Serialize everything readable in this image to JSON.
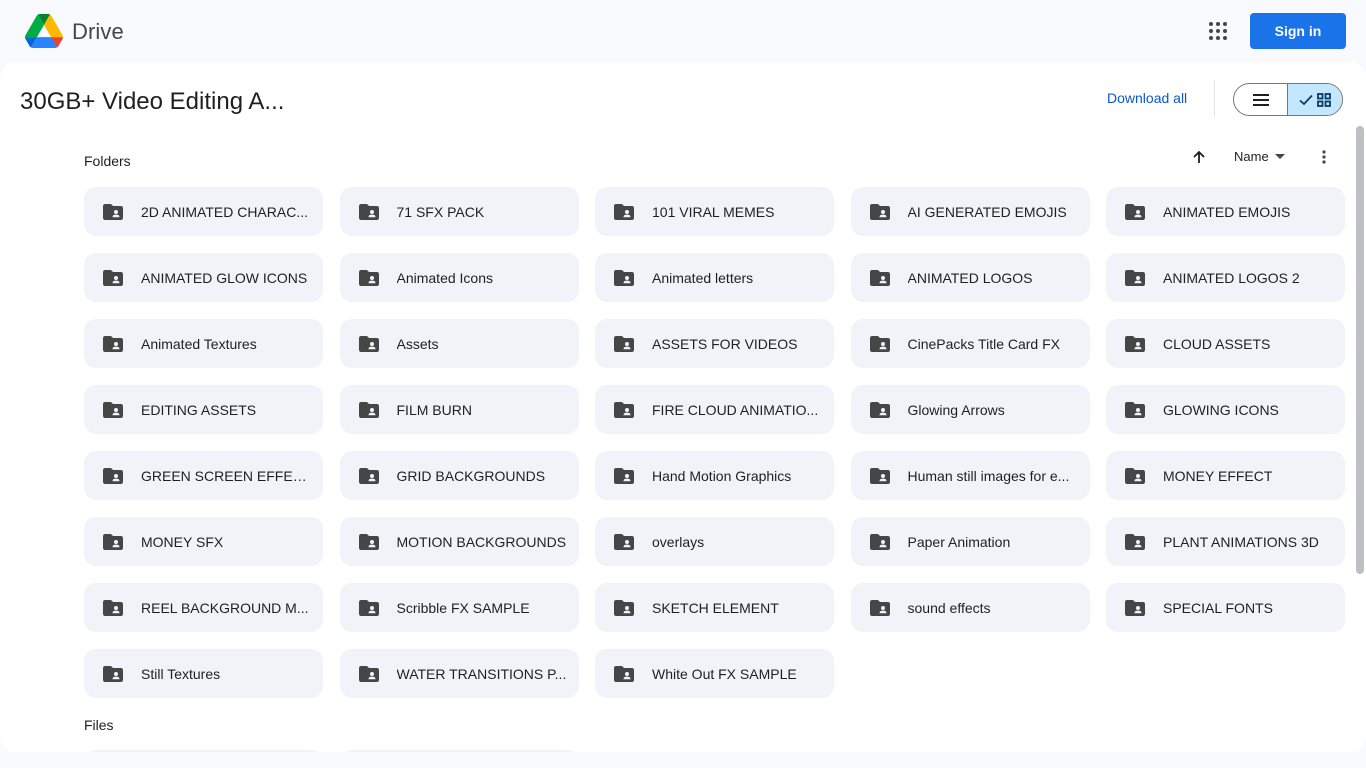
{
  "header": {
    "brand": "Drive",
    "sign_in_label": "Sign in",
    "apps_icon": "apps-grid-icon",
    "logo_colors": {
      "green": "#0f9d58",
      "yellow": "#ffba00",
      "blue": "#4285f4",
      "red": "#ea4335",
      "dark_blue": "#1967d2",
      "dark_green": "#188038"
    }
  },
  "toolbar": {
    "title": "30GB+ Video Editing A...",
    "download_all": "Download all"
  },
  "sections": {
    "folders_label": "Folders",
    "files_label": "Files"
  },
  "sort": {
    "label": "Name"
  },
  "colors": {
    "accent": "#1a73e8",
    "link": "#0b57d0",
    "card_bg": "#f0f4f9",
    "selected_toggle": "#c2e7ff"
  },
  "folders": [
    {
      "name": "2D ANIMATED CHARAC..."
    },
    {
      "name": "71 SFX PACK"
    },
    {
      "name": "101 VIRAL MEMES"
    },
    {
      "name": "AI GENERATED EMOJIS"
    },
    {
      "name": "ANIMATED EMOJIS"
    },
    {
      "name": "ANIMATED GLOW ICONS"
    },
    {
      "name": "Animated Icons"
    },
    {
      "name": "Animated letters"
    },
    {
      "name": "ANIMATED LOGOS"
    },
    {
      "name": "ANIMATED LOGOS 2"
    },
    {
      "name": "Animated Textures"
    },
    {
      "name": "Assets"
    },
    {
      "name": "ASSETS FOR VIDEOS"
    },
    {
      "name": "CinePacks Title Card FX"
    },
    {
      "name": "CLOUD ASSETS"
    },
    {
      "name": "EDITING ASSETS"
    },
    {
      "name": "FILM BURN"
    },
    {
      "name": "FIRE CLOUD ANIMATIO..."
    },
    {
      "name": "Glowing Arrows"
    },
    {
      "name": "GLOWING ICONS"
    },
    {
      "name": "GREEN SCREEN EFFECTS"
    },
    {
      "name": "GRID BACKGROUNDS"
    },
    {
      "name": "Hand Motion Graphics"
    },
    {
      "name": "Human still images for e..."
    },
    {
      "name": "MONEY EFFECT"
    },
    {
      "name": "MONEY SFX"
    },
    {
      "name": "MOTION BACKGROUNDS"
    },
    {
      "name": "overlays"
    },
    {
      "name": "Paper Animation"
    },
    {
      "name": "PLANT ANIMATIONS 3D"
    },
    {
      "name": "REEL BACKGROUND M..."
    },
    {
      "name": "Scribble FX SAMPLE"
    },
    {
      "name": "SKETCH ELEMENT"
    },
    {
      "name": "sound effects"
    },
    {
      "name": "SPECIAL FONTS"
    },
    {
      "name": "Still Textures"
    },
    {
      "name": "WATER TRANSITIONS P..."
    },
    {
      "name": "White Out FX SAMPLE"
    }
  ]
}
